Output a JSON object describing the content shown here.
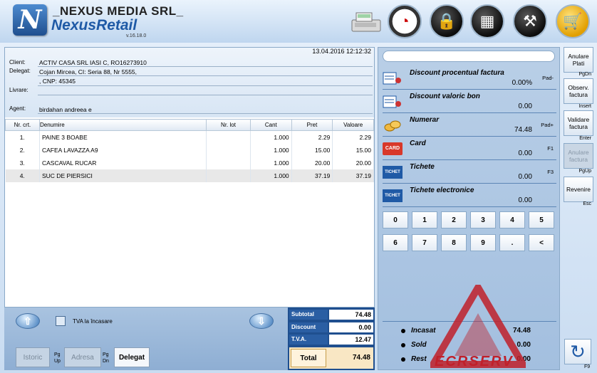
{
  "header": {
    "logo_letter": "N",
    "company": "_NEXUS MEDIA SRL_",
    "product": "NexusRetail",
    "version": "v.16.18.0",
    "icons": [
      "cash-register-icon",
      "gauge-icon",
      "lock-icon",
      "calculator-icon",
      "tools-icon",
      "cart-icon"
    ]
  },
  "document": {
    "timestamp": "13.04.2016 12:12:32",
    "client_label": "Client:",
    "client_value": "ACTIV CASA SRL IASI  C, RO16273910",
    "delegat_label": "Delegat:",
    "delegat_value_line1": "Cojan Mircea, CI: Seria 88, Nr 5555,",
    "delegat_value_line2": ", CNP: 45345",
    "livrare_label": "Livrare:",
    "agent_label": "Agent:",
    "agent_value": "birdahan andreea e"
  },
  "table": {
    "headers": [
      "Nr. crt.",
      "Denumire",
      "Nr. lot",
      "Cant",
      "Pret",
      "Valoare"
    ],
    "rows": [
      {
        "nr": "1.",
        "name": "PAINE 3 BOABE",
        "lot": "",
        "cant": "1.000",
        "pret": "2.29",
        "valoare": "2.29"
      },
      {
        "nr": "2.",
        "name": "CAFEA LAVAZZA A9",
        "lot": "",
        "cant": "1.000",
        "pret": "15.00",
        "valoare": "15.00"
      },
      {
        "nr": "3.",
        "name": "CASCAVAL RUCAR",
        "lot": "",
        "cant": "1.000",
        "pret": "20.00",
        "valoare": "20.00"
      },
      {
        "nr": "4.",
        "name": "SUC DE PIERSICI",
        "lot": "",
        "cant": "1.000",
        "pret": "37.19",
        "valoare": "37.19"
      }
    ]
  },
  "bottom": {
    "tva_label": "TVA la încasare",
    "istoric": "Istoric",
    "adresa": "Adresa",
    "delegat": "Delegat",
    "key_pgup": "Pg Up",
    "key_pgdn": "Pg Dn"
  },
  "totals": {
    "subtotal_label": "Subtotal",
    "subtotal": "74.48",
    "discount_label": "Discount",
    "discount": "0.00",
    "tva_label": "T.V.A.",
    "tva": "12.47",
    "total_label": "Total",
    "total": "74.48"
  },
  "payments": {
    "items": [
      {
        "name": "Discount procentual factura",
        "value": "0.00%",
        "key": "Pad-",
        "icon": "discount-percent-icon"
      },
      {
        "name": "Discount valoric bon",
        "value": "0.00",
        "key": "",
        "icon": "discount-value-icon"
      },
      {
        "name": "Numerar",
        "value": "74.48",
        "key": "Pad+",
        "icon": "coins-icon"
      },
      {
        "name": "Card",
        "value": "0.00",
        "key": "F1",
        "icon": "card-icon",
        "icon_text": "CARD"
      },
      {
        "name": "Tichete",
        "value": "0.00",
        "key": "F3",
        "icon": "ticket-icon",
        "icon_text": "TICHET"
      },
      {
        "name": "Tichete electronice",
        "value": "0.00",
        "key": "",
        "icon": "eticket-icon",
        "icon_text": "TICHET"
      }
    ],
    "keypad": [
      "0",
      "1",
      "2",
      "3",
      "4",
      "5",
      "6",
      "7",
      "8",
      "9",
      ".",
      "<"
    ],
    "incasat_label": "Incasat",
    "incasat": "74.48",
    "sold_label": "Sold",
    "sold": "0.00",
    "rest_label": "Rest",
    "rest": "0.00"
  },
  "side_buttons": [
    {
      "label": "Anulare Plati",
      "key": "PgDn",
      "enabled": true
    },
    {
      "label": "Observ. factura",
      "key": "Insert",
      "enabled": true
    },
    {
      "label": "Validare factura",
      "key": "Enter",
      "enabled": true
    },
    {
      "label": "Anulare factura",
      "key": "PgUp",
      "enabled": false
    },
    {
      "label": "Revenire",
      "key": "Esc",
      "enabled": true
    }
  ],
  "refresh_key": "F9",
  "watermark": "ECRSERV",
  "colors": {
    "accent": "#1f5aa6",
    "totals_bg": "#1f4f8f",
    "watermark": "#c0202a"
  }
}
